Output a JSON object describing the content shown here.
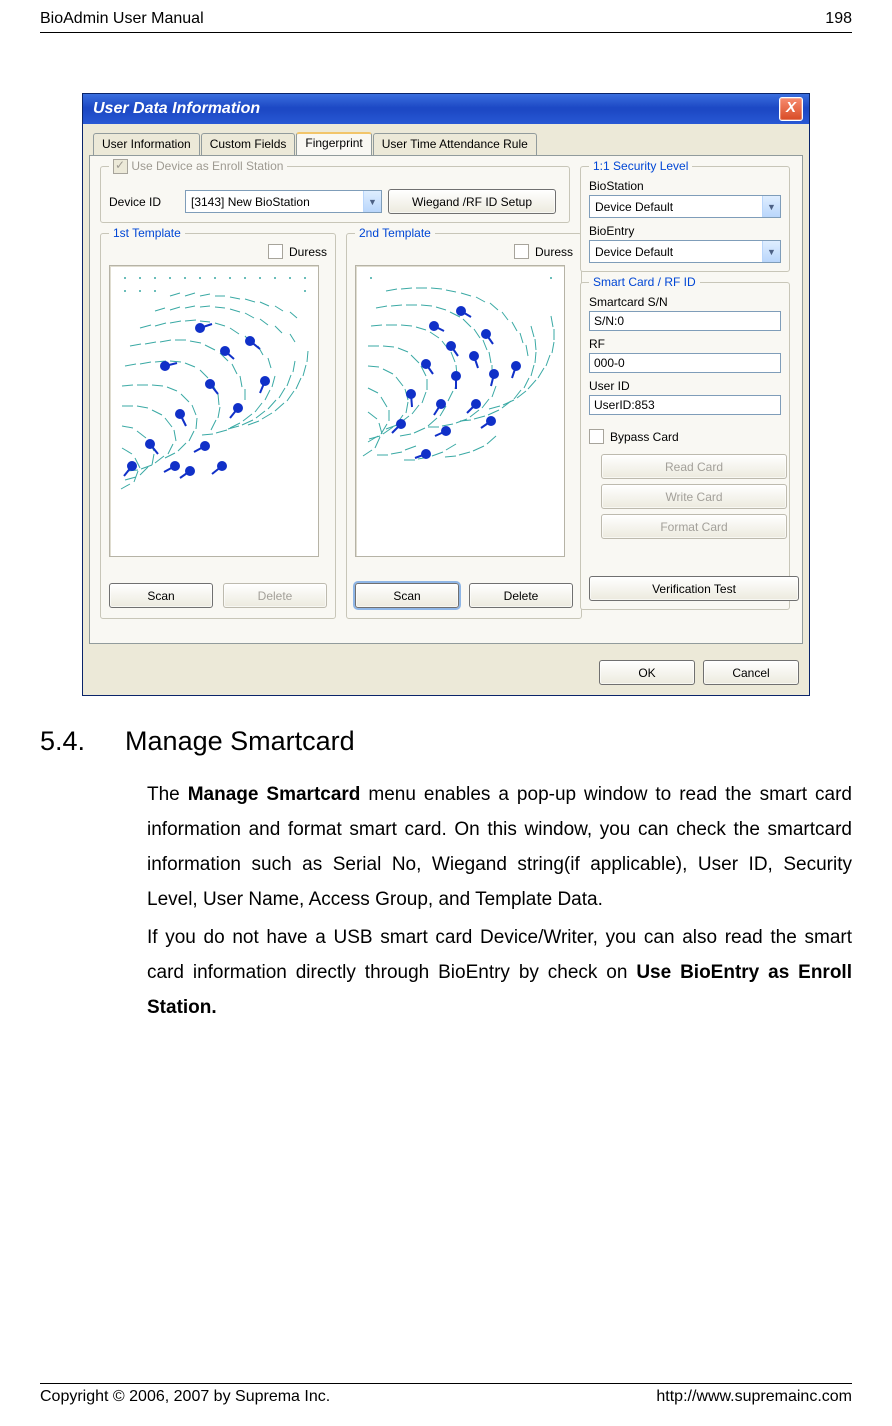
{
  "doc": {
    "header_left": "BioAdmin User Manual",
    "header_right": "198",
    "footer_left": "Copyright © 2006, 2007 by Suprema Inc.",
    "footer_right": "http://www.supremainc.com"
  },
  "dialog": {
    "title": "User Data Information",
    "close": "X",
    "tabs": [
      "User Information",
      "Custom Fields",
      "Fingerprint",
      "User Time Attendance Rule"
    ],
    "active_tab_index": 2,
    "enroll": {
      "checkbox_label": "Use Device as Enroll Station",
      "device_id_label": "Device ID",
      "device_id_value": "[3143] New BioStation",
      "wiegand_btn": "Wiegand /RF ID Setup"
    },
    "template1": {
      "title": "1st Template",
      "duress": "Duress",
      "scan": "Scan",
      "delete": "Delete"
    },
    "template2": {
      "title": "2nd Template",
      "duress": "Duress",
      "scan": "Scan",
      "delete": "Delete"
    },
    "security": {
      "title": "1:1 Security Level",
      "biostation_label": "BioStation",
      "biostation_value": "Device Default",
      "bioentry_label": "BioEntry",
      "bioentry_value": "Device Default"
    },
    "smartcard": {
      "title": "Smart Card / RF ID",
      "sn_label": "Smartcard S/N",
      "sn_value": "S/N:0",
      "rf_label": "RF",
      "rf_value": "000-0",
      "userid_label": "User ID",
      "userid_value": "UserID:853",
      "bypass": "Bypass Card",
      "read": "Read Card",
      "write": "Write Card",
      "format": "Format Card",
      "verify": "Verification Test"
    },
    "ok": "OK",
    "cancel": "Cancel"
  },
  "section": {
    "number": "5.4.",
    "title": "Manage Smartcard",
    "para1_a": "The ",
    "para1_b": "Manage Smartcard",
    "para1_c": " menu enables a pop-up window to read the smart card information and format smart card. On this window, you can check the smartcard information such as Serial No, Wiegand string(if applicable), User ID, Security Level, User Name, Access Group, and Template Data.",
    "para2_a": "If you do not have a USB smart card Device/Writer, you can also read the smart card information directly through BioEntry by check on ",
    "para2_b": "Use BioEntry as Enroll Station."
  }
}
